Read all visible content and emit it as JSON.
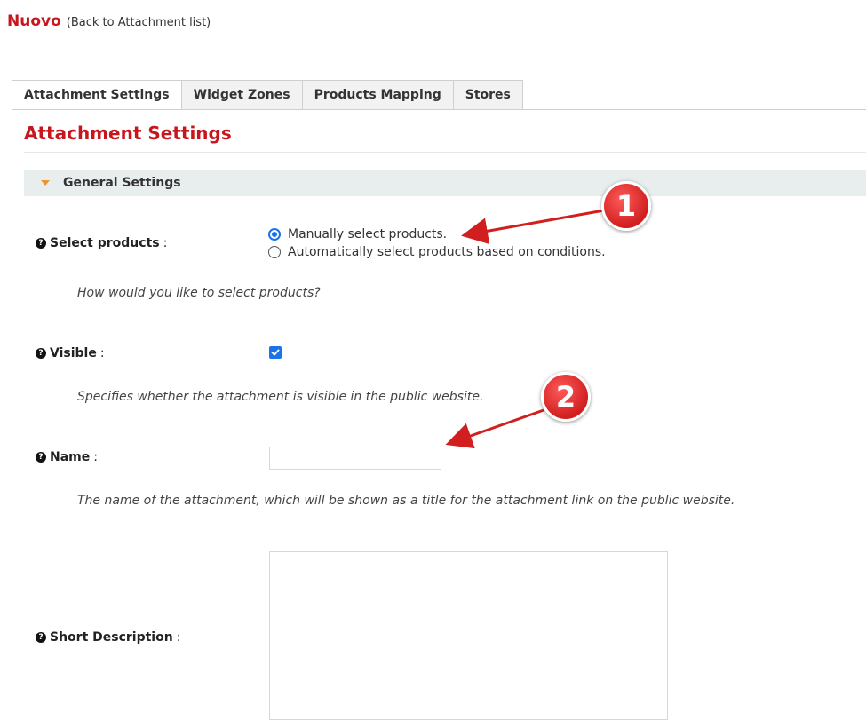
{
  "header": {
    "title": "Nuovo",
    "back_link": "(Back to Attachment list)"
  },
  "tabs": [
    {
      "label": "Attachment Settings",
      "active": true
    },
    {
      "label": "Widget Zones",
      "active": false
    },
    {
      "label": "Products Mapping",
      "active": false
    },
    {
      "label": "Stores",
      "active": false
    }
  ],
  "panel": {
    "heading": "Attachment Settings",
    "section": {
      "title": "General Settings",
      "expanded": true
    }
  },
  "fields": {
    "select_products": {
      "label": "Select products",
      "options": [
        {
          "label": "Manually select products.",
          "checked": true
        },
        {
          "label": "Automatically select products based on conditions.",
          "checked": false
        }
      ],
      "hint": "How would you like to select products?"
    },
    "visible": {
      "label": "Visible",
      "checked": true,
      "hint": "Specifies whether the attachment is visible in the public website."
    },
    "name": {
      "label": "Name",
      "value": "",
      "hint": "The name of the attachment, which will be shown as a title for the attachment link on the public website."
    },
    "short_description": {
      "label": "Short Description",
      "value": ""
    }
  },
  "annotations": {
    "callout_1": "1",
    "callout_2": "2"
  },
  "colors": {
    "title_red": "#c8161d",
    "section_bg": "#e8eeee",
    "caret": "#f0922d",
    "accent_blue": "#1a73e8",
    "callout_red": "#d11f1f"
  }
}
